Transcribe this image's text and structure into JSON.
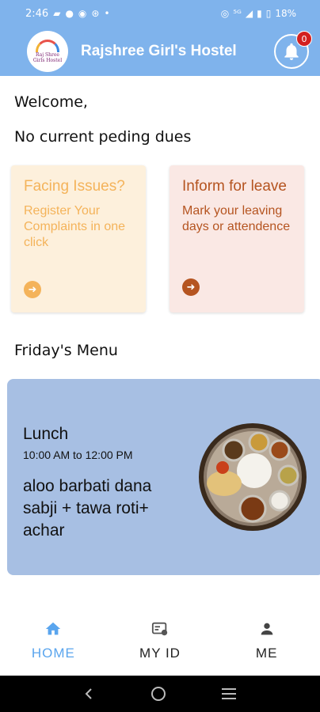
{
  "status": {
    "time": "2:46",
    "icons_left": [
      "message-icon",
      "chat-icon",
      "whatsapp-icon",
      "settings-icon",
      "dot-icon"
    ],
    "icons_right": [
      "hotspot-icon",
      "network-5g-icon",
      "wifi-icon",
      "signal-icon",
      "battery-icon"
    ],
    "battery": "18%"
  },
  "header": {
    "logo_text_1": "Raj Shree",
    "logo_text_2": "Girls Hostel",
    "title": "Rajshree Girl's Hostel",
    "notification_count": "0"
  },
  "main": {
    "welcome": "Welcome,",
    "dues": "No current peding dues"
  },
  "cards": {
    "issue": {
      "title": "Facing Issues?",
      "desc": "Register Your Complaints in one click",
      "color": "#f4b35a"
    },
    "leave": {
      "title": "Inform for leave",
      "desc": "Mark your leaving days or attendence",
      "color": "#b55420"
    }
  },
  "menu": {
    "heading": "Friday's Menu",
    "meal": "Lunch",
    "time": "10:00 AM to 12:00 PM",
    "items": "aloo barbati dana sabji + tawa roti+ achar"
  },
  "nav": {
    "home": "HOME",
    "myid": "MY ID",
    "me": "ME",
    "active_color": "#5aa5ee"
  },
  "colors": {
    "accent": "#7fb3ec",
    "menu_card": "#a7bfe3"
  }
}
